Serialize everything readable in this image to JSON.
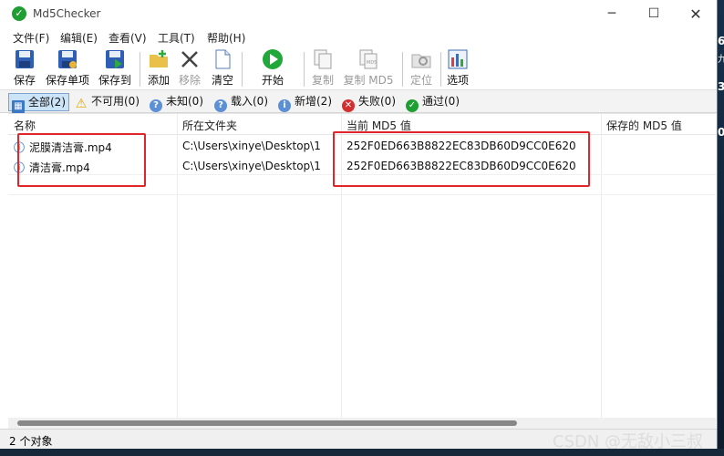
{
  "window": {
    "title": "Md5Checker"
  },
  "menu": [
    "文件(F)",
    "编辑(E)",
    "查看(V)",
    "工具(T)",
    "帮助(H)"
  ],
  "toolbar": {
    "save": "保存",
    "save_single": "保存单项",
    "save_to": "保存到",
    "add": "添加",
    "remove": "移除",
    "clear": "清空",
    "start": "开始",
    "copy": "复制",
    "copy_md5": "复制 MD5",
    "locate": "定位",
    "options": "选项"
  },
  "filters": {
    "all": "全部(2)",
    "unavailable": "不可用(0)",
    "unknown": "未知(0)",
    "loaded": "载入(0)",
    "added": "新增(2)",
    "failed": "失败(0)",
    "passed": "通过(0)"
  },
  "columns": [
    "名称",
    "所在文件夹",
    "当前 MD5 值",
    "保存的 MD5 值"
  ],
  "rows": [
    {
      "name": "泥膜清洁膏.mp4",
      "folder": "C:\\Users\\xinye\\Desktop\\1",
      "md5": "252F0ED663B8822EC83DB60D9CC0E620",
      "saved": ""
    },
    {
      "name": "清洁膏.mp4",
      "folder": "C:\\Users\\xinye\\Desktop\\1",
      "md5": "252F0ED663B8822EC83DB60D9CC0E620",
      "saved": ""
    }
  ],
  "status": "2 个对象",
  "watermark": "CSDN @无敌小三叔",
  "desktop_edge": [
    "6",
    "九",
    "3",
    "0"
  ],
  "colors": {
    "accent": "#1f9e32",
    "highlight_box": "#e0262a"
  }
}
